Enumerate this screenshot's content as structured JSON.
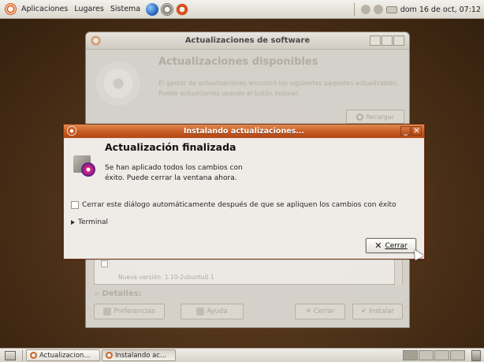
{
  "top_panel": {
    "menus": [
      "Aplicaciones",
      "Lugares",
      "Sistema"
    ],
    "clock": "dom 16 de oct, 07:12"
  },
  "background_window": {
    "title": "Actualizaciones de software",
    "heading": "Actualizaciones disponibles",
    "description": "El gestor de actualizaciones encontró los siguientes paquetes actualizables. Puede actualizarlos usando el botón Instalar.",
    "reload_label": "Recargar",
    "package_new_version": "Nueva versión: 1.10-2ubuntu0.1",
    "details_label": "Detalles:",
    "preferences_label": "Preferencias",
    "help_label": "Ayuda",
    "close_label": "Cerrar",
    "install_label": "Instalar"
  },
  "dialog": {
    "title": "Instalando actualizaciones...",
    "heading": "Actualización finalizada",
    "body_line1": "Se han aplicado todos los cambios con",
    "body_line2": "éxito. Puede cerrar la ventana ahora.",
    "auto_close_label": "Cerrar este diálogo automáticamente después de que se apliquen los cambios con éxito",
    "auto_close_checked": false,
    "terminal_label": "Terminal",
    "close_button_label": "Cerrar"
  },
  "bottom_panel": {
    "tasks": [
      {
        "label": "Actualizacion...",
        "active": false
      },
      {
        "label": "Instalando ac...",
        "active": true
      }
    ]
  },
  "colors": {
    "dialog_titlebar": "#c75a22",
    "desktop": "#4f3219"
  }
}
